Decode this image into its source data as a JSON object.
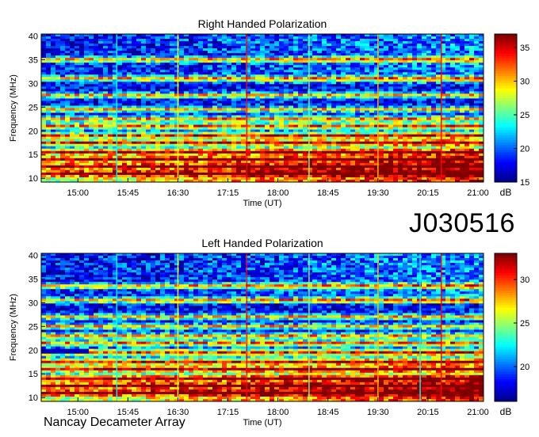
{
  "observation_id": "J030516",
  "instrument": "Nancay Decameter Array",
  "colors": {
    "colormap": [
      "#00008f",
      "#0000ff",
      "#007fff",
      "#00ffff",
      "#7fff7f",
      "#ffff00",
      "#ff7f00",
      "#ff0000",
      "#800000"
    ]
  },
  "chart_data": [
    {
      "type": "heatmap",
      "title": "Right Handed Polarization",
      "xlabel": "Time (UT)",
      "ylabel": "Frequency (MHz)",
      "x_ticks": [
        "15:00",
        "15:45",
        "16:30",
        "17:15",
        "18:00",
        "18:45",
        "19:30",
        "20:15",
        "21:00"
      ],
      "y_ticks": [
        10,
        15,
        20,
        25,
        30,
        35,
        40
      ],
      "ylim": [
        10,
        40
      ],
      "colorbar": {
        "label": "dB",
        "ticks": [
          15,
          20,
          25,
          30,
          35
        ],
        "range": [
          15,
          37
        ]
      },
      "bright_bands_mhz": [
        11,
        12.5,
        14,
        15.5,
        17.5,
        19,
        21,
        22.5,
        24.5,
        27.5,
        31,
        35
      ],
      "vertical_features": [
        {
          "time": "15:35",
          "color": "#00ffff"
        },
        {
          "time": "16:30",
          "color": "#ffff00"
        },
        {
          "time": "17:32",
          "color": "#ff0000"
        },
        {
          "time": "18:28",
          "color": "#7fff7f"
        },
        {
          "time": "19:30",
          "color": "#ffbf00"
        },
        {
          "time": "20:27",
          "color": "#ff0000"
        }
      ],
      "grid": false
    },
    {
      "type": "heatmap",
      "title": "Left Handed Polarization",
      "xlabel": "Time (UT)",
      "ylabel": "Frequency (MHz)",
      "x_ticks": [
        "15:00",
        "15:45",
        "16:30",
        "17:15",
        "18:00",
        "18:45",
        "19:30",
        "20:15",
        "21:00"
      ],
      "y_ticks": [
        10,
        15,
        20,
        25,
        30,
        35,
        40
      ],
      "ylim": [
        10,
        40
      ],
      "colorbar": {
        "label": "dB",
        "ticks": [
          20,
          25,
          30
        ],
        "range": [
          16,
          33
        ]
      },
      "bright_bands_mhz": [
        11,
        12.5,
        14,
        16,
        17.5,
        19.5,
        21.5,
        23,
        25,
        27,
        30.5,
        33.5
      ],
      "vertical_features": [
        {
          "time": "15:35",
          "color": "#00ffff"
        },
        {
          "time": "16:30",
          "color": "#ffff00"
        },
        {
          "time": "17:32",
          "color": "#ff0000"
        },
        {
          "time": "18:28",
          "color": "#7fff7f"
        },
        {
          "time": "19:30",
          "color": "#ffbf00"
        },
        {
          "time": "20:08",
          "color": "#00ffff"
        },
        {
          "time": "20:27",
          "color": "#ff0000"
        }
      ],
      "grid": false
    }
  ]
}
